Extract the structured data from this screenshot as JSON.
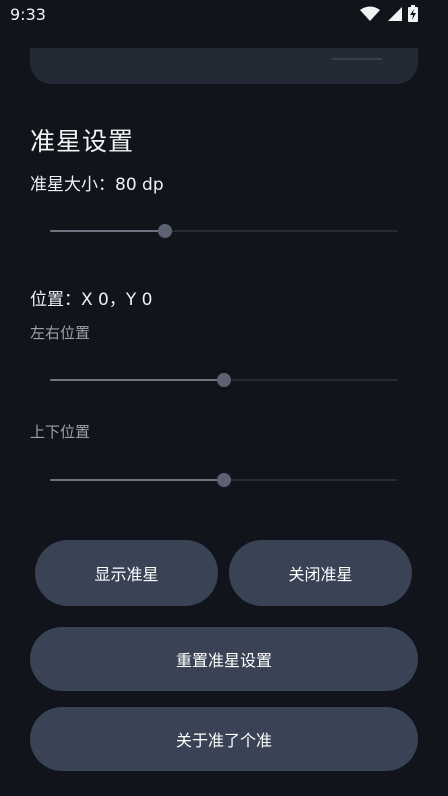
{
  "status_bar": {
    "time": "9:33"
  },
  "crosshair_settings": {
    "title": "准星设置",
    "size_label": "准星大小：80 dp",
    "size_value": 0.33,
    "position_label": "位置：X 0，Y 0",
    "horizontal_label": "左右位置",
    "horizontal_value": 0.5,
    "vertical_label": "上下位置",
    "vertical_value": 0.5
  },
  "buttons": {
    "show": "显示准星",
    "close": "关闭准星",
    "reset": "重置准星设置",
    "about": "关于准了个准"
  },
  "colors": {
    "background": "#11141b",
    "button": "#394355",
    "slider_thumb": "#5c6272",
    "slider_active": "#6f7381",
    "slider_inactive": "#262a32"
  }
}
